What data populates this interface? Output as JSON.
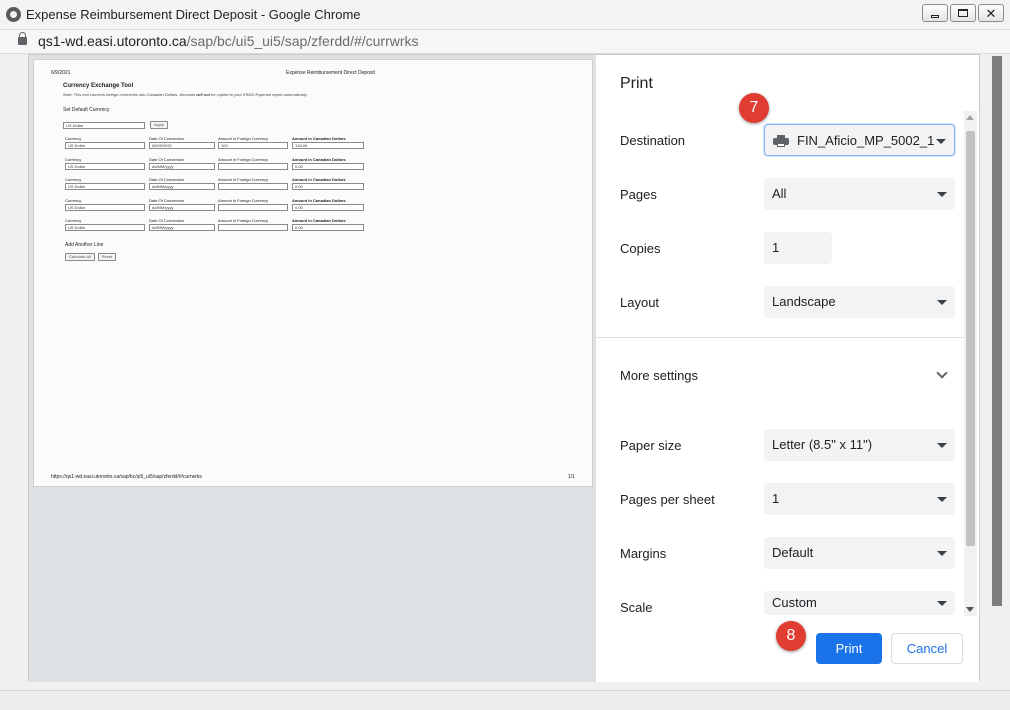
{
  "window": {
    "title": "Expense Reimbursement Direct Deposit - Google Chrome",
    "url_host": "qs1-wd.easi.utoronto.ca",
    "url_path": "/sap/bc/ui5_ui5/sap/zferdd/#/currwrks"
  },
  "preview": {
    "date": "6/9/2021",
    "header_title": "Expense Reimbursement Direct Deposit",
    "tool_title": "Currency Exchange Tool",
    "note_prefix": "Note: This tool converts foreign currencies into Canadian Dollars. Amounts ",
    "note_bold": "will not",
    "note_suffix": " be copied to your ERDD Expense report automatically",
    "set_default_label": "Set Default Currency",
    "default_currency": "US Dollar",
    "apply_btn": "Apply",
    "headers": {
      "currency": "Currency",
      "date": "Date Of Conversion",
      "foreign": "Amount in Foreign Currency",
      "cad": "Amount in Canadian Dollars"
    },
    "rows": [
      {
        "currency": "US Dollar",
        "date": "06/09/2021",
        "foreign": "100",
        "cad": "128.06"
      },
      {
        "currency": "US Dollar",
        "date": "dd/MM/yyyy",
        "foreign": "",
        "cad": "0.00"
      },
      {
        "currency": "US Dollar",
        "date": "dd/MM/yyyy",
        "foreign": "",
        "cad": "0.00"
      },
      {
        "currency": "US Dollar",
        "date": "dd/MM/yyyy",
        "foreign": "",
        "cad": "0.00"
      },
      {
        "currency": "US Dollar",
        "date": "dd/MM/yyyy",
        "foreign": "",
        "cad": "0.00"
      }
    ],
    "add_line": "Add Another Line",
    "calc_all_btn": "Calculate All",
    "reset_btn": "Reset",
    "footer_url": "https://qs1-wd.easi.utoronto.ca/sap/bc/ui5_ui5/sap/zferdd/#/currwrks",
    "page_number": "1/1"
  },
  "settings": {
    "title": "Print",
    "destination_label": "Destination",
    "destination_value": "FIN_Aficio_MP_5002_1",
    "pages_label": "Pages",
    "pages_value": "All",
    "copies_label": "Copies",
    "copies_value": "1",
    "layout_label": "Layout",
    "layout_value": "Landscape",
    "more_settings_label": "More settings",
    "paper_size_label": "Paper size",
    "paper_size_value": "Letter (8.5\" x 11\")",
    "pages_per_sheet_label": "Pages per sheet",
    "pages_per_sheet_value": "1",
    "margins_label": "Margins",
    "margins_value": "Default",
    "scale_label": "Scale",
    "scale_value": "Custom",
    "print_btn": "Print",
    "cancel_btn": "Cancel"
  },
  "annotations": {
    "step7": "7",
    "step8": "8",
    "color": "#e03c31"
  },
  "colors": {
    "accent": "#1a73e8",
    "preview_bg": "#dee1e4",
    "control_bg": "#f1f3f4"
  }
}
